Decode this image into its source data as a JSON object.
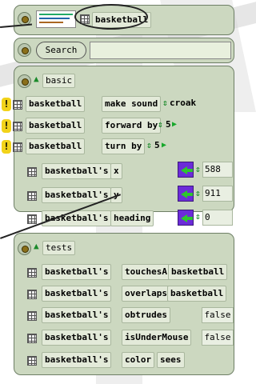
{
  "header": {
    "object_name": "basketball"
  },
  "search": {
    "label": "Search",
    "value": ""
  },
  "categories": [
    {
      "name": "basic",
      "rows": [
        {
          "warn": "!",
          "subject": "basketball",
          "command": "make sound",
          "arg_value": "croak"
        },
        {
          "warn": "!",
          "subject": "basketball",
          "command": "forward by",
          "arg_value": "5"
        },
        {
          "warn": "!",
          "subject": "basketball",
          "command": "turn by",
          "arg_value": "5"
        },
        {
          "subject": "basketball's",
          "command": "x",
          "value": "588"
        },
        {
          "subject": "basketball's",
          "command": "y",
          "value": "911"
        },
        {
          "subject": "basketball's",
          "command": "heading",
          "value": "0"
        }
      ]
    },
    {
      "name": "tests",
      "rows": [
        {
          "subject": "basketball's",
          "command": "touchesA",
          "arg": "basketball"
        },
        {
          "subject": "basketball's",
          "command": "overlaps",
          "arg": "basketball"
        },
        {
          "subject": "basketball's",
          "command": "obtrudes",
          "result": "false"
        },
        {
          "subject": "basketball's",
          "command": "isUnderMouse",
          "result": "false"
        },
        {
          "subject": "basketball's",
          "command": "color",
          "arg": "sees"
        }
      ]
    }
  ],
  "colors": {
    "panel": "#ccd8c0",
    "accent_green": "#1a8a2a",
    "warn_yellow": "#f2d31a",
    "arrow_purple": "#6c2bd9"
  }
}
